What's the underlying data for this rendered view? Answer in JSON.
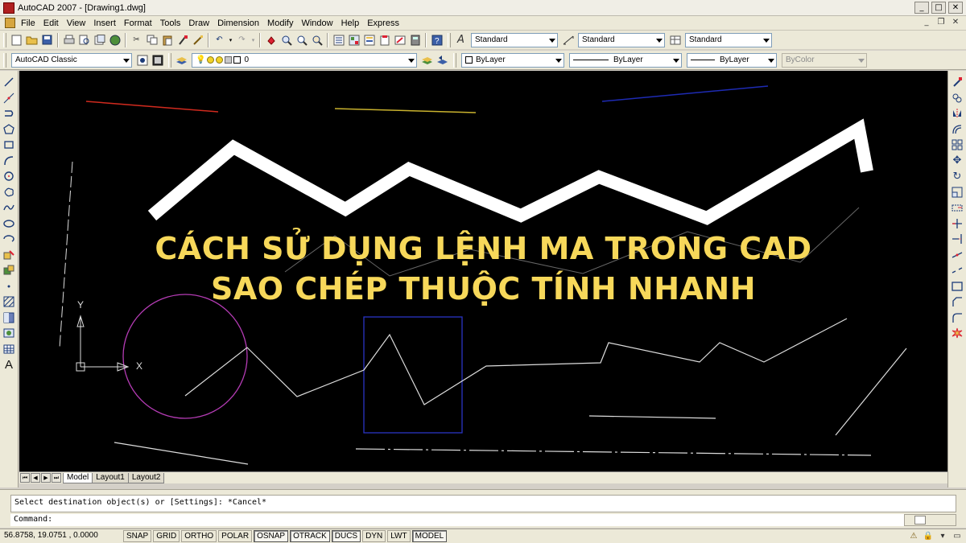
{
  "window": {
    "title": "AutoCAD 2007 - [Drawing1.dwg]",
    "buttons": {
      "minimize": "_",
      "maximize": "□",
      "close": "✕"
    },
    "mdi_buttons": {
      "minimize": "_",
      "restore": "❐",
      "close": "✕"
    }
  },
  "menu": [
    "File",
    "Edit",
    "View",
    "Insert",
    "Format",
    "Tools",
    "Draw",
    "Dimension",
    "Modify",
    "Window",
    "Help",
    "Express"
  ],
  "toolbar_standard": {
    "text_style": "Standard",
    "dim_style": "Standard",
    "table_style": "Standard"
  },
  "toolbar_layers": {
    "workspace": "AutoCAD Classic",
    "layer": "0",
    "color": "ByLayer",
    "linetype": "ByLayer",
    "lineweight": "ByLayer",
    "plot_style": "ByColor"
  },
  "overlay": {
    "line1": "CÁCH SỬ DỤNG LỆNH MA TRONG CAD",
    "line2": "SAO CHÉP THUỘC TÍNH NHANH"
  },
  "ucs": {
    "y_label": "Y",
    "x_label": "X"
  },
  "layout_tabs": [
    "Model",
    "Layout1",
    "Layout2"
  ],
  "active_tab": "Model",
  "command": {
    "history": "Select destination object(s) or [Settings]: *Cancel*",
    "prompt": "Command:"
  },
  "status": {
    "coords": "56.8758, 19.0751 , 0.0000",
    "buttons": [
      "SNAP",
      "GRID",
      "ORTHO",
      "POLAR",
      "OSNAP",
      "OTRACK",
      "DUCS",
      "DYN",
      "LWT",
      "MODEL"
    ],
    "active": [
      "OSNAP",
      "OTRACK",
      "DUCS",
      "MODEL"
    ]
  },
  "colors": {
    "canvas": "#000000",
    "overlay_text": "#f7d85a",
    "red_line": "#d02a1e",
    "yellow_line": "#c9b22e",
    "blue_line": "#1e2bb4",
    "circle": "#b53cb5",
    "rect": "#2a34c4"
  }
}
